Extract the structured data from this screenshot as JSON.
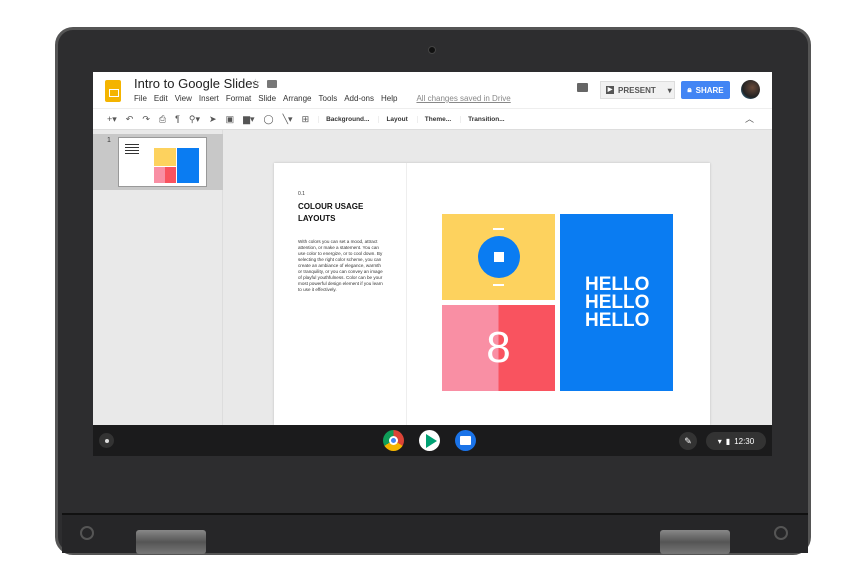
{
  "doc": {
    "title": "Intro to Google Slides",
    "saved": "All changes saved in Drive"
  },
  "menu": [
    "File",
    "Edit",
    "View",
    "Insert",
    "Format",
    "Slide",
    "Arrange",
    "Tools",
    "Add-ons",
    "Help"
  ],
  "header": {
    "present": "PRESENT",
    "share": "SHARE"
  },
  "toolbar": {
    "background": "Background...",
    "layout": "Layout",
    "theme": "Theme...",
    "transition": "Transition..."
  },
  "filmstrip": {
    "slide_number": "1"
  },
  "slide": {
    "number": "0.1",
    "heading": "COLOUR USAGE LAYOUTS",
    "body": "With colors you can set a mood, attract attention, or make a statement. You can use color to energize, or to cool down. By selecting the right color scheme, you can create an ambiance of elegance, warmth or tranquility, or you can convey an image of playful youthfulness. Color can be your most powerful design element if you learn to use it effectively.",
    "big_number": "8",
    "hello": [
      "HELLO",
      "HELLO",
      "HELLO"
    ]
  },
  "shelf": {
    "time": "12:30"
  },
  "colors": {
    "yellow": "#fdd25e",
    "blue": "#0a7cf2",
    "pink": "#f98fa4",
    "red": "#f9535f",
    "share": "#4285f4"
  }
}
